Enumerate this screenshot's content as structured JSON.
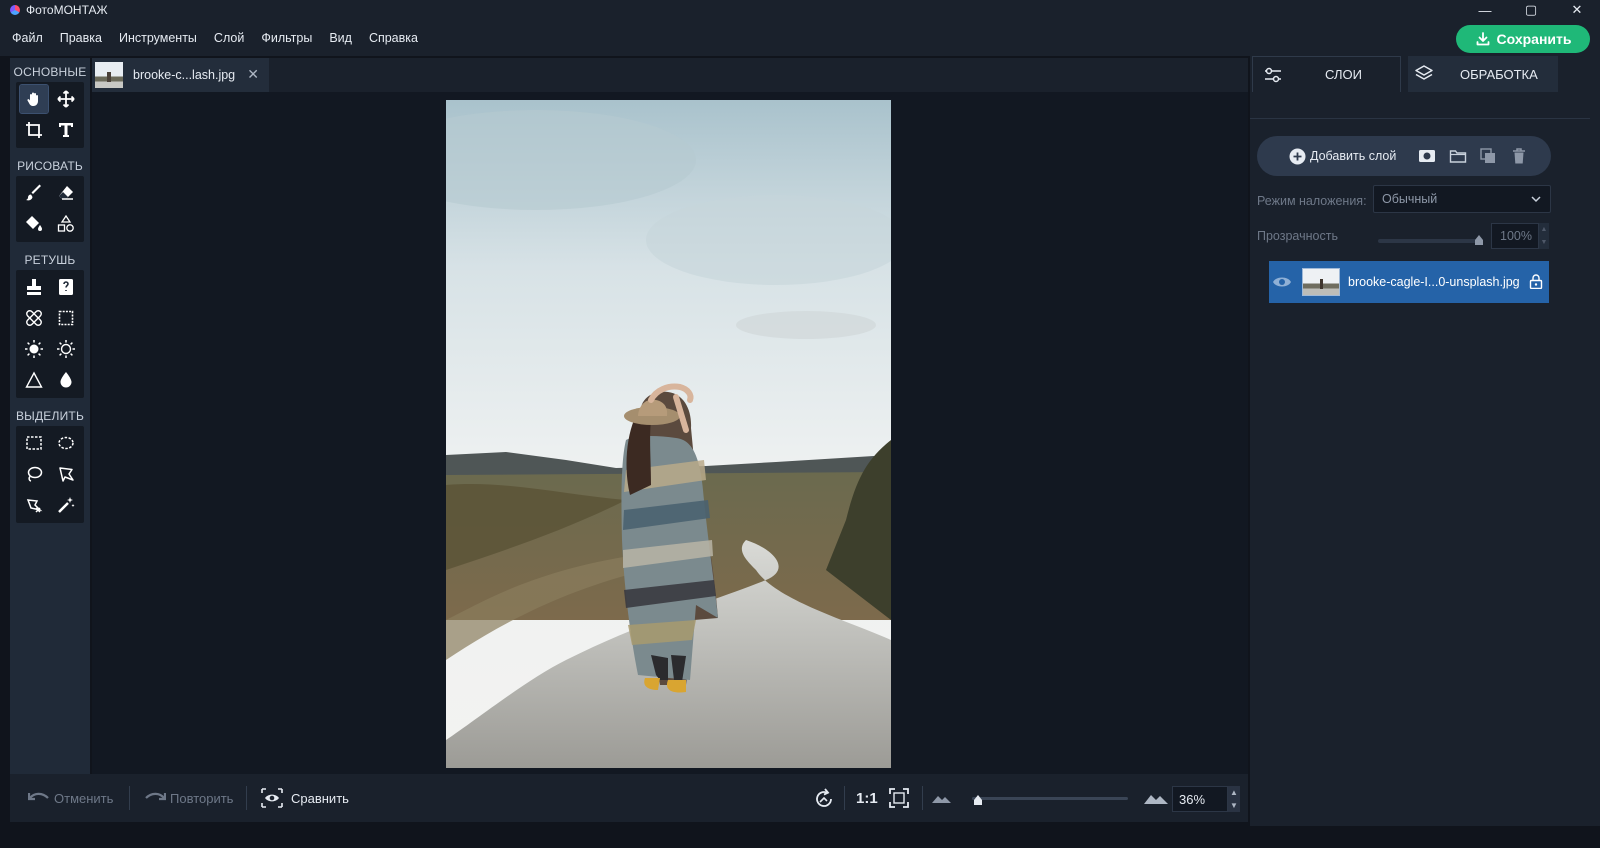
{
  "app": {
    "title": "ФотоМОНТАЖ"
  },
  "window_controls": {
    "minimize": "—",
    "maximize": "▢",
    "close": "✕"
  },
  "menu": [
    "Файл",
    "Правка",
    "Инструменты",
    "Слой",
    "Фильтры",
    "Вид",
    "Справка"
  ],
  "save_button": "Сохранить",
  "toolbar": {
    "sections": [
      {
        "title": "ОСНОВНЫЕ",
        "tools": [
          "hand-icon",
          "move-icon",
          "crop-icon",
          "text-icon"
        ]
      },
      {
        "title": "РИСОВАТЬ",
        "tools": [
          "brush-icon",
          "eraser-icon",
          "fill-icon",
          "shapes-icon"
        ]
      },
      {
        "title": "РЕТУШЬ",
        "tools": [
          "stamp-icon",
          "patch-icon",
          "healing-icon",
          "blur-region-icon",
          "lighten-icon",
          "darken-icon",
          "sharpen-icon",
          "drop-icon"
        ]
      },
      {
        "title": "ВЫДЕЛИТЬ",
        "tools": [
          "rect-select-icon",
          "ellipse-select-icon",
          "lasso-icon",
          "polygon-lasso-icon",
          "magnetic-lasso-icon",
          "magic-wand-icon"
        ]
      }
    ],
    "active_tool": "hand-icon"
  },
  "document_tab": {
    "label": "brooke-c...lash.jpg",
    "close": "✕"
  },
  "bottom_bar": {
    "undo": "Отменить",
    "redo": "Повторить",
    "compare": "Сравнить",
    "actual_size": "1:1",
    "zoom_value": "36%",
    "zoom_level": 0.03
  },
  "right_panel": {
    "tabs": [
      {
        "label": "СЛОИ",
        "icon": "sliders-icon",
        "active": true
      },
      {
        "label": "ОБРАБОТКА",
        "icon": "layers-icon",
        "active": false
      }
    ],
    "add_layer": "Добавить слой",
    "blend_label": "Режим наложения:",
    "blend_value": "Обычный",
    "opacity_label": "Прозрачность",
    "opacity_value": "100%",
    "layers": [
      {
        "name": "brooke-cagle-I...0-unsplash.jpg",
        "visible": true,
        "locked": true
      }
    ]
  },
  "colors": {
    "accent": "#1fb878",
    "selection": "#2563a8",
    "panel": "#1a212c",
    "canvas": "#121822"
  }
}
